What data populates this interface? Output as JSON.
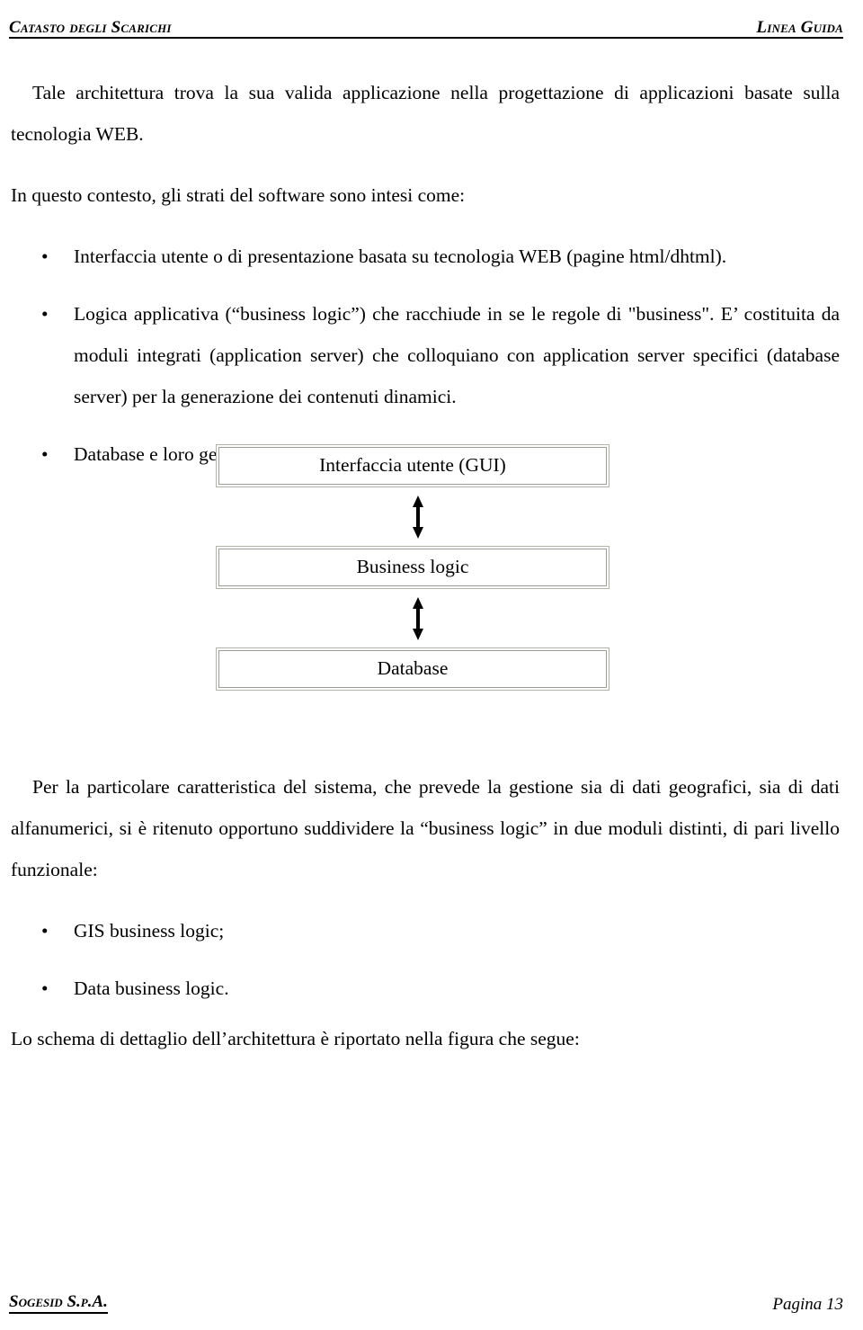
{
  "header": {
    "left": "Catasto degli Scarichi",
    "right": "Linea Guida"
  },
  "body": {
    "paragraph_1": "Tale architettura trova la sua valida applicazione nella progettazione di applicazioni basate sulla tecnologia WEB.",
    "paragraph_2": "In questo contesto, gli strati del software sono intesi come:",
    "bullet_marker": "•",
    "list_1": [
      "Interfaccia utente o di presentazione basata su tecnologia WEB (pagine html/dhtml).",
      "Logica applicativa (“business logic”) che racchiude in se le regole di \"business\". E’ costituita da moduli integrati (application server) che colloquiano con application server specifici (database server) per la generazione dei contenuti dinamici.",
      "Database e loro gestione."
    ],
    "paragraph_3": "Per la particolare caratteristica del sistema, che prevede la gestione sia di dati geografici, sia di dati alfanumerici, si è ritenuto opportuno suddividere la “business logic” in due moduli distinti, di pari livello funzionale:",
    "list_2": [
      "GIS business logic;",
      "Data business logic."
    ],
    "paragraph_4": "Lo schema di dettaglio dell’architettura è riportato nella figura che segue:"
  },
  "diagram": {
    "type": "layered-architecture",
    "layers": [
      {
        "label": "Interfaccia utente (GUI)"
      },
      {
        "label": "Business logic"
      },
      {
        "label": "Database"
      }
    ],
    "connector": "double-headed-vertical-arrow",
    "connector_count": 2,
    "box_border_color": "#b2b2a8",
    "box_inner_border_color": "#9d9d94",
    "box_shadow_color": "#efefe7"
  },
  "footer": {
    "left": "Sogesid S.p.A.",
    "right": "Pagina 13"
  }
}
